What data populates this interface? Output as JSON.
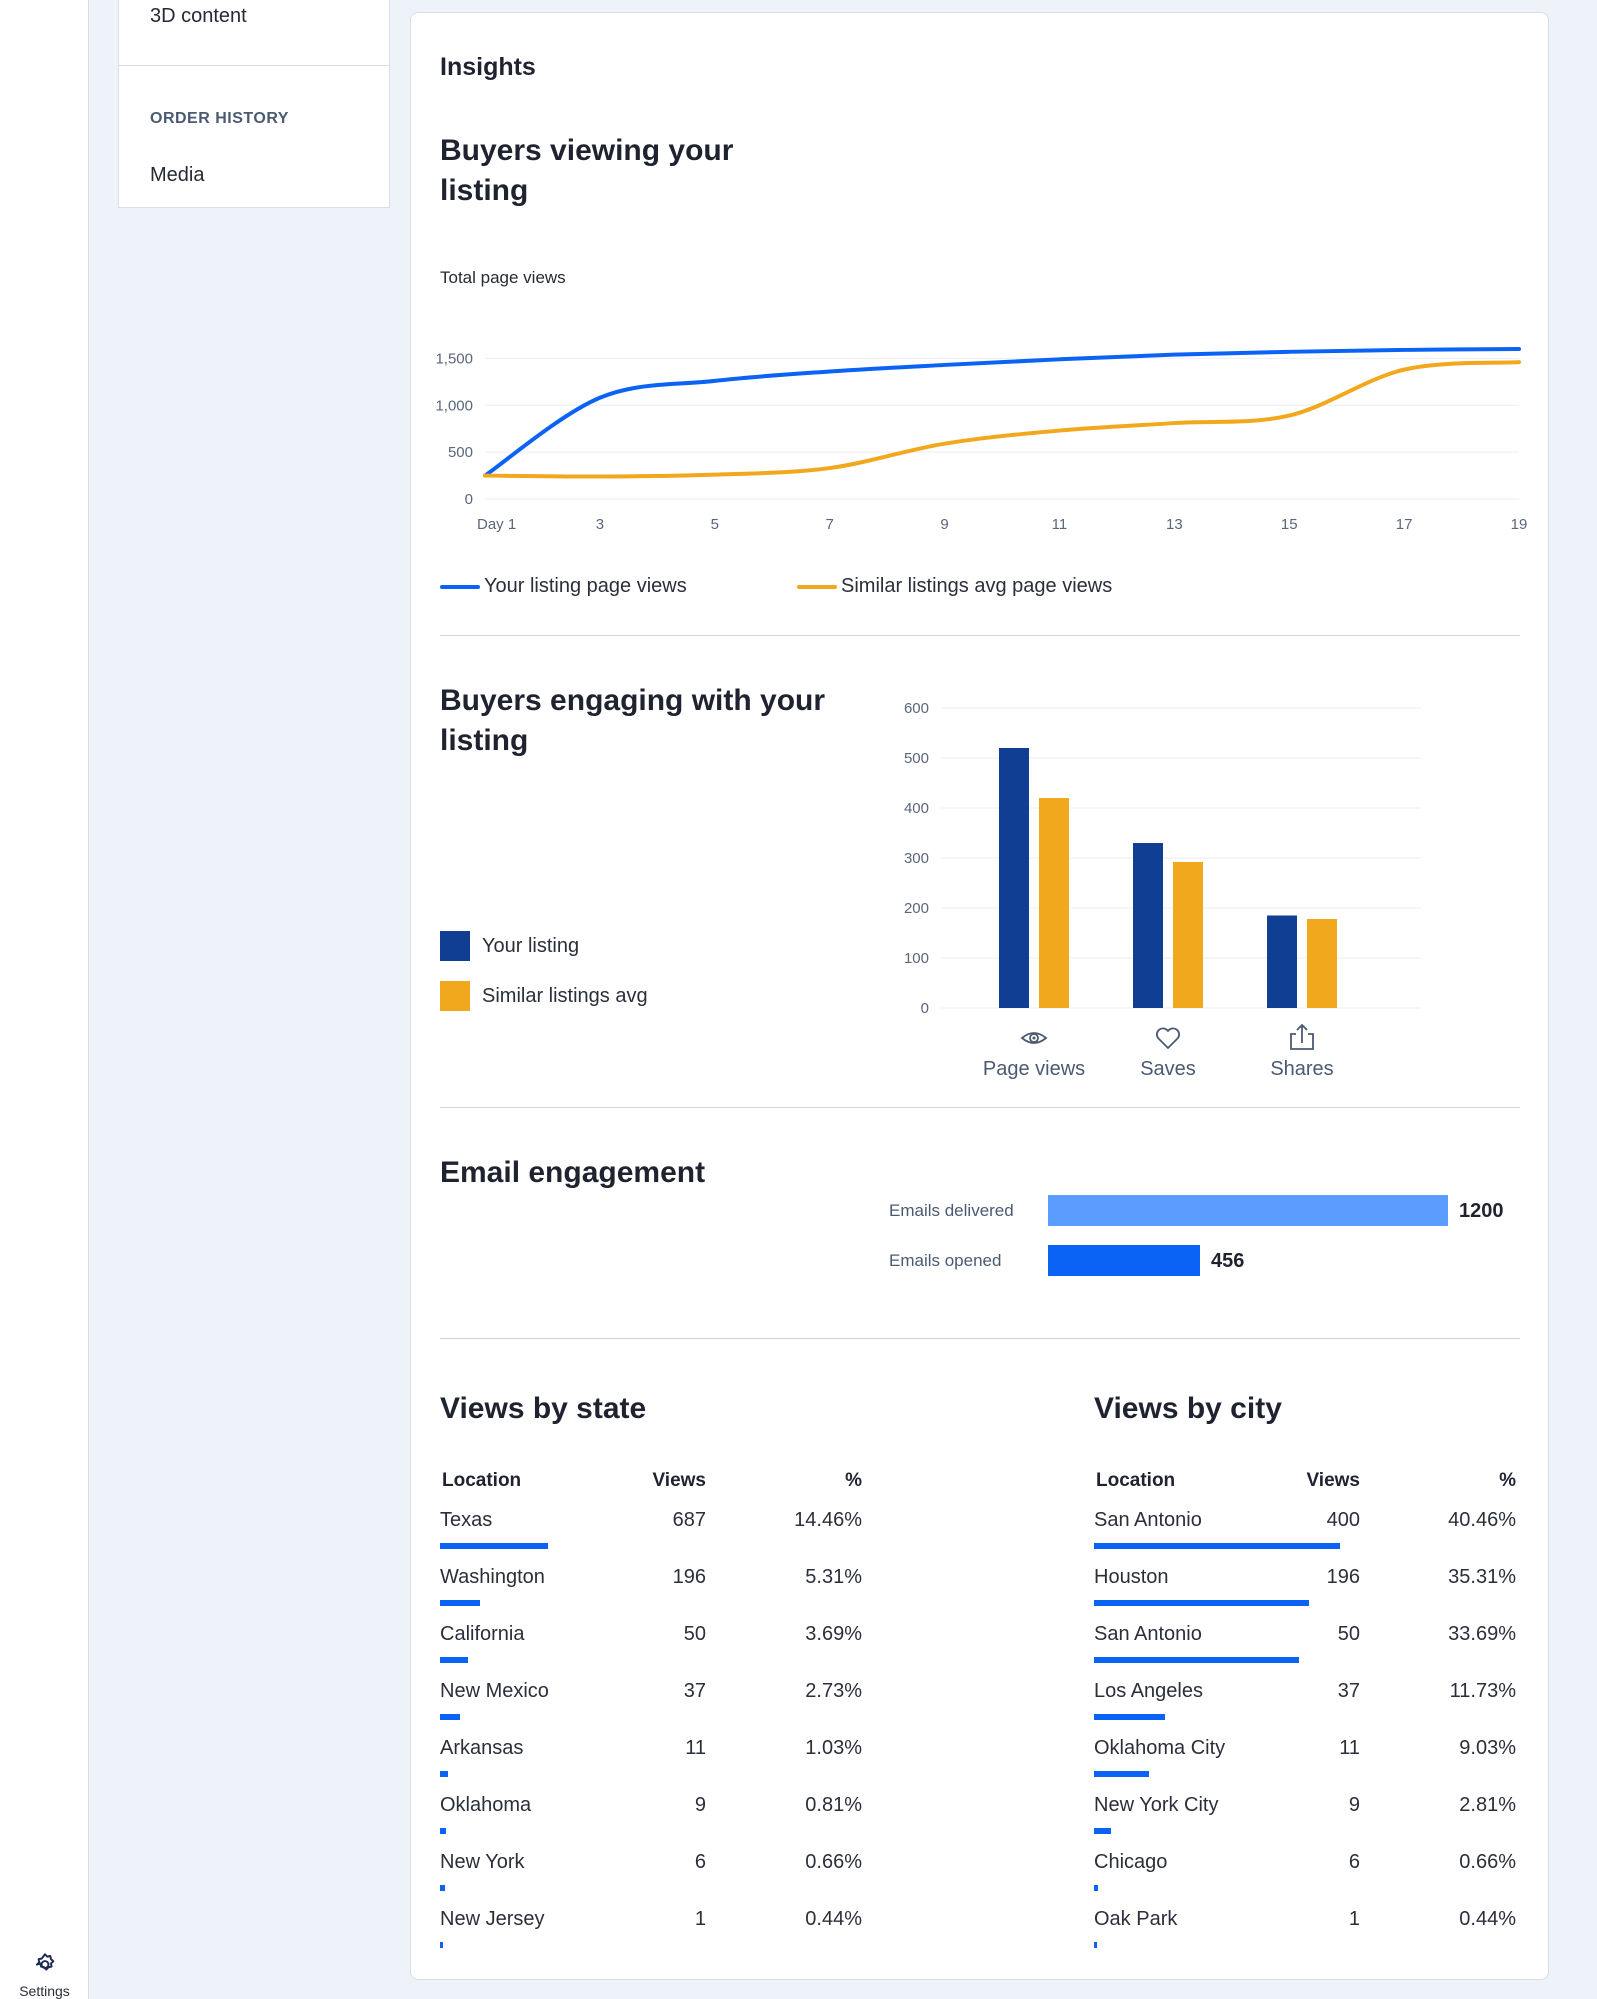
{
  "sidebar": {
    "settings_label": "Settings"
  },
  "subnav": {
    "item_3d": "3D content",
    "order_history_heading": "ORDER HISTORY",
    "item_media": "Media"
  },
  "insights": {
    "title": "Insights",
    "viewing": {
      "title_line1": "Buyers viewing your",
      "title_line2": "listing",
      "subtitle": "Total page views",
      "legend": [
        "Your listing page views",
        "Similar listings avg page views"
      ]
    },
    "engaging": {
      "title_line1": "Buyers engaging with your",
      "title_line2": "listing",
      "legend": [
        "Your listing",
        "Similar listings avg"
      ]
    },
    "email": {
      "title": "Email engagement",
      "rows": [
        {
          "label": "Emails delivered",
          "value": "1200"
        },
        {
          "label": "Emails opened",
          "value": "456"
        }
      ]
    },
    "by_state": {
      "title": "Views by state",
      "headers": [
        "Location",
        "Views",
        "%"
      ],
      "rows": [
        {
          "location": "Texas",
          "views": "687",
          "pct": "14.46%",
          "share": 0.1446
        },
        {
          "location": "Washington",
          "views": "196",
          "pct": "5.31%",
          "share": 0.0531
        },
        {
          "location": "California",
          "views": "50",
          "pct": "3.69%",
          "share": 0.0369
        },
        {
          "location": "New Mexico",
          "views": "37",
          "pct": "2.73%",
          "share": 0.0273
        },
        {
          "location": "Arkansas",
          "views": "11",
          "pct": "1.03%",
          "share": 0.0103
        },
        {
          "location": "Oklahoma",
          "views": "9",
          "pct": "0.81%",
          "share": 0.0081
        },
        {
          "location": "New York",
          "views": "6",
          "pct": "0.66%",
          "share": 0.0066
        },
        {
          "location": "New Jersey",
          "views": "1",
          "pct": "0.44%",
          "share": 0.0044
        }
      ]
    },
    "by_city": {
      "title": "Views by city",
      "headers": [
        "Location",
        "Views",
        "%"
      ],
      "rows": [
        {
          "location": "San Antonio",
          "views": "400",
          "pct": "40.46%",
          "share": 0.4046
        },
        {
          "location": "Houston",
          "views": "196",
          "pct": "35.31%",
          "share": 0.3531
        },
        {
          "location": "San Antonio",
          "views": "50",
          "pct": "33.69%",
          "share": 0.3369
        },
        {
          "location": "Los Angeles",
          "views": "37",
          "pct": "11.73%",
          "share": 0.1173
        },
        {
          "location": "Oklahoma City",
          "views": "11",
          "pct": "9.03%",
          "share": 0.0903
        },
        {
          "location": "New York City",
          "views": "9",
          "pct": "2.81%",
          "share": 0.0281
        },
        {
          "location": "Chicago",
          "views": "6",
          "pct": "0.66%",
          "share": 0.0066
        },
        {
          "location": "Oak Park",
          "views": "1",
          "pct": "0.44%",
          "share": 0.0044
        }
      ]
    }
  },
  "colors": {
    "your_line": "#0b63f6",
    "similar_line": "#f2a81d",
    "your_bar": "#0f3e93",
    "similar_bar": "#f2a81d",
    "email_delivered": "#5b9cff",
    "email_opened": "#0b63f6",
    "location_bar": "#0b63f6"
  },
  "chart_data": [
    {
      "type": "line",
      "title": "Total page views",
      "x": [
        1,
        3,
        5,
        7,
        9,
        11,
        13,
        15,
        17,
        19
      ],
      "x_tick_labels": [
        "Day 1",
        "3",
        "5",
        "7",
        "9",
        "11",
        "13",
        "15",
        "17",
        "19"
      ],
      "y_tick_labels": [
        "0",
        "500",
        "1,000",
        "1,500"
      ],
      "ylim": [
        0,
        1600
      ],
      "grid": true,
      "series": [
        {
          "name": "Your listing page views",
          "values": [
            250,
            1080,
            1260,
            1360,
            1430,
            1490,
            1540,
            1570,
            1590,
            1600
          ],
          "color": "#0b63f6"
        },
        {
          "name": "Similar listings avg page views",
          "values": [
            250,
            240,
            260,
            330,
            590,
            730,
            810,
            890,
            1380,
            1460
          ],
          "color": "#f2a81d"
        }
      ]
    },
    {
      "type": "bar",
      "categories": [
        "Page views",
        "Saves",
        "Shares"
      ],
      "category_icons": [
        "eye-icon",
        "heart-icon",
        "share-icon"
      ],
      "y_tick_labels": [
        "0",
        "100",
        "200",
        "300",
        "400",
        "500",
        "600"
      ],
      "ylim": [
        0,
        600
      ],
      "grid": true,
      "series": [
        {
          "name": "Your listing",
          "values": [
            520,
            330,
            185
          ],
          "color": "#0f3e93"
        },
        {
          "name": "Similar listings avg",
          "values": [
            420,
            292,
            178
          ],
          "color": "#f2a81d"
        }
      ]
    },
    {
      "type": "bar",
      "orientation": "horizontal",
      "categories": [
        "Emails delivered",
        "Emails opened"
      ],
      "values": [
        1200,
        456
      ],
      "xlim": [
        0,
        1200
      ]
    }
  ]
}
